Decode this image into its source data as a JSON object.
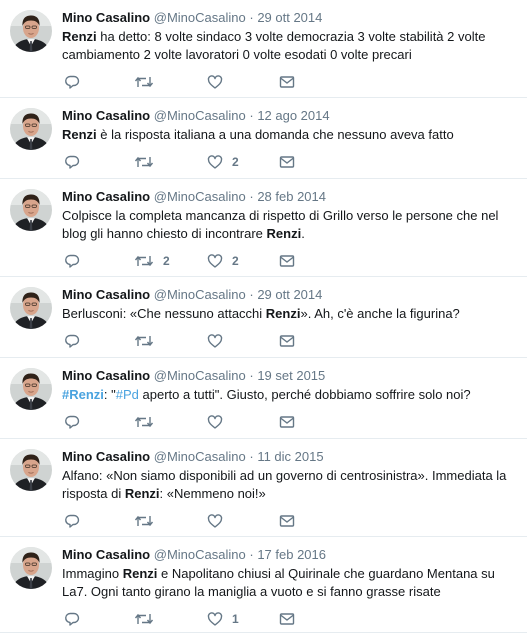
{
  "tweets": [
    {
      "name": "Mino Casalino",
      "handle": "@MinoCasalino",
      "separator": "·",
      "date": "29 ott 2014",
      "body": [
        {
          "t": "Renzi",
          "b": true
        },
        {
          "t": " ha detto: 8 volte sindaco 3 volte democrazia 3 volte stabilità 2 volte cambiamento 2 volte lavoratori 0 volte esodati 0 volte precari"
        }
      ],
      "retweets": "",
      "likes": ""
    },
    {
      "name": "Mino Casalino",
      "handle": "@MinoCasalino",
      "separator": "·",
      "date": "12 ago 2014",
      "body": [
        {
          "t": "Renzi",
          "b": true
        },
        {
          "t": " è la risposta italiana a una domanda che nessuno aveva fatto"
        }
      ],
      "retweets": "",
      "likes": "2"
    },
    {
      "name": "Mino Casalino",
      "handle": "@MinoCasalino",
      "separator": "·",
      "date": "28 feb 2014",
      "body": [
        {
          "t": "Colpisce la completa mancanza di rispetto di Grillo verso le persone che nel blog gli hanno chiesto di incontrare "
        },
        {
          "t": "Renzi",
          "b": true
        },
        {
          "t": "."
        }
      ],
      "retweets": "2",
      "likes": "2"
    },
    {
      "name": "Mino Casalino",
      "handle": "@MinoCasalino",
      "separator": "·",
      "date": "29 ott 2014",
      "body": [
        {
          "t": "Berlusconi: «Che nessuno attacchi "
        },
        {
          "t": "Renzi",
          "b": true
        },
        {
          "t": "».  Ah, c'è anche la figurina?"
        }
      ],
      "retweets": "",
      "likes": ""
    },
    {
      "name": "Mino Casalino",
      "handle": "@MinoCasalino",
      "separator": "·",
      "date": "19 set 2015",
      "body": [
        {
          "t": "#Renzi",
          "h": true,
          "b": true
        },
        {
          "t": ": \""
        },
        {
          "t": "#Pd",
          "h": true
        },
        {
          "t": " aperto a tutti\". Giusto, perché dobbiamo soffrire solo noi?"
        }
      ],
      "retweets": "",
      "likes": ""
    },
    {
      "name": "Mino Casalino",
      "handle": "@MinoCasalino",
      "separator": "·",
      "date": "11 dic 2015",
      "body": [
        {
          "t": "Alfano: «Non siamo disponibili ad un governo di centrosinistra». Immediata la risposta di "
        },
        {
          "t": "Renzi",
          "b": true
        },
        {
          "t": ": «Nemmeno noi!»"
        }
      ],
      "retweets": "",
      "likes": ""
    },
    {
      "name": "Mino Casalino",
      "handle": "@MinoCasalino",
      "separator": "·",
      "date": "17 feb 2016",
      "body": [
        {
          "t": "Immagino "
        },
        {
          "t": "Renzi",
          "b": true
        },
        {
          "t": " e Napolitano chiusi al Quirinale che guardano Mentana su La7. Ogni tanto girano la maniglia a vuoto e si fanno grasse risate"
        }
      ],
      "retweets": "",
      "likes": "1"
    }
  ],
  "icons": {
    "reply": "reply-icon",
    "retweet": "retweet-icon",
    "like": "heart-icon",
    "dm": "envelope-icon"
  },
  "colors": {
    "text": "#14171a",
    "secondary": "#657786",
    "hashtag": "#4aa3df",
    "divider": "#e6ecf0"
  }
}
